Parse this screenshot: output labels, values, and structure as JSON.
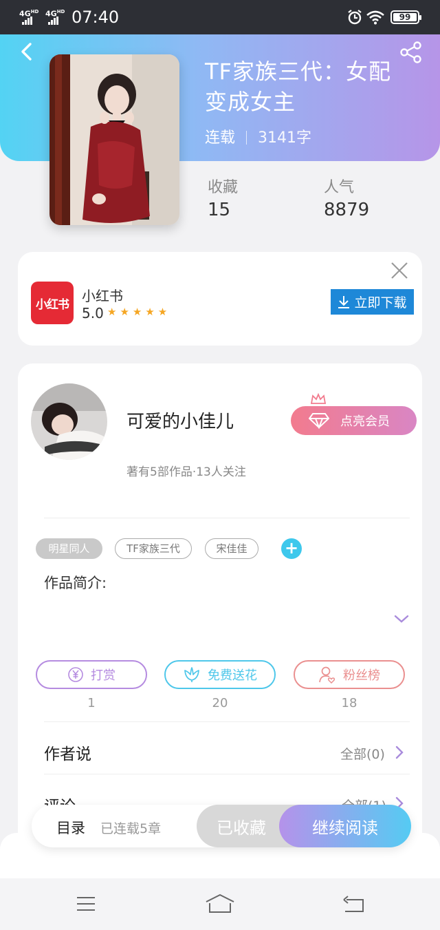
{
  "status_bar": {
    "network_1": "4G",
    "network_1_sup": "HD",
    "network_2": "4G",
    "network_2_sup": "HD",
    "time": "07:40",
    "battery": "99"
  },
  "book": {
    "title": "TF家族三代：女配变成女主",
    "status": "连载",
    "word_count": "3141字",
    "favorites_label": "收藏",
    "favorites_value": "15",
    "popularity_label": "人气",
    "popularity_value": "8879"
  },
  "ad": {
    "logo_text": "小红书",
    "app_name": "小红书",
    "rating": "5.0",
    "stars": "★★★★★",
    "download_label": "立即下载"
  },
  "author": {
    "name": "可爱的小佳儿",
    "meta": "著有5部作品·13人关注",
    "vip_label": "点亮会员"
  },
  "tags": [
    "明星同人",
    "TF家族三代",
    "宋佳佳"
  ],
  "tag_add": "+",
  "intro_label": "作品简介:",
  "actions": [
    {
      "label": "打赏",
      "count": "1",
      "color": "#b58be0",
      "icon": "yen-icon"
    },
    {
      "label": "免费送花",
      "count": "20",
      "color": "#4ec7ea",
      "icon": "flower-icon"
    },
    {
      "label": "粉丝榜",
      "count": "18",
      "color": "#ea8f8f",
      "icon": "fan-icon"
    }
  ],
  "rows": [
    {
      "label": "作者说",
      "link": "全部(0)"
    },
    {
      "label": "评论",
      "link": "全部(1)"
    }
  ],
  "bottom_bar": {
    "toc_label": "目录",
    "chapters": "已连载5章",
    "saved_label": "已收藏",
    "read_label": "继续阅读"
  },
  "colors": {
    "header_gradient_start": "#53d3f3",
    "header_gradient_end": "#b695e8",
    "accent_cyan": "#3ec8ec",
    "download_blue": "#1e88d8"
  }
}
